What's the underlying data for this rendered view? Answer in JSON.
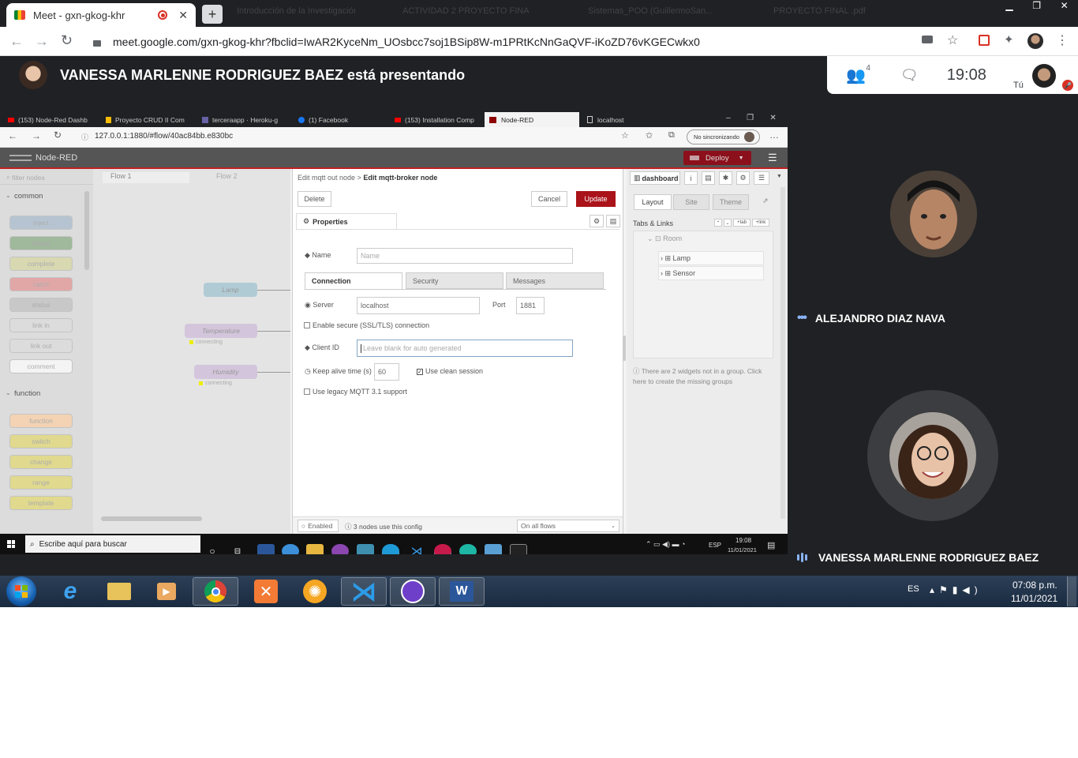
{
  "browser": {
    "active_tab_title": "Meet - gxn-gkog-khr",
    "other_tabs": [
      "Introducción de la Investigación",
      "ACTIVIDAD 2 PROYECTO FINAL",
      "Sistemas_POO (GuillermoSan...",
      "PROYECTO FINAL .pdf"
    ],
    "url": "meet.google.com/gxn-gkog-khr?fbclid=IwAR2KyceNm_UOsbcc7soj1BSip8W-m1PRtKcNnGaQVF-iKoZD76vKGECwkx0"
  },
  "meet": {
    "presenter_text": "VANESSA MARLENNE RODRIGUEZ BAEZ está presentando",
    "participant_count": "4",
    "clock": "19:08",
    "self_label": "Tú",
    "participants": [
      "ALEJANDRO DIAZ NAVA",
      "VANESSA MARLENNE RODRIGUEZ BAEZ"
    ]
  },
  "shared": {
    "edge_tabs": [
      "(153) Node-Red Dashb",
      "Proyecto CRUD II Com",
      "terceraapp · Heroku-g",
      "(1) Facebook",
      "(153) Installation Comp",
      "Node-RED",
      "localhost"
    ],
    "edge_url": "127.0.0.1:1880/#flow/40ac84bb.e830bc",
    "sync_label": "No sincronizando",
    "app_title": "Node-RED",
    "deploy_label": "Deploy",
    "filter_placeholder": "filter nodes",
    "palette": {
      "common_title": "common",
      "common": [
        "inject",
        "debug",
        "complete",
        "catch",
        "status",
        "link in",
        "link out",
        "comment"
      ],
      "function_title": "function",
      "function": [
        "function",
        "switch",
        "change",
        "range",
        "template"
      ]
    },
    "flow_tabs": [
      "Flow 1",
      "Flow 2"
    ],
    "flow_nodes": [
      "Lamp",
      "Temperature",
      "Humidity"
    ],
    "connecting": "connecting",
    "editor": {
      "breadcrumb_1": "Edit mqtt out node >",
      "breadcrumb_2": "Edit mqtt-broker node",
      "delete": "Delete",
      "cancel": "Cancel",
      "update": "Update",
      "properties": "Properties",
      "name_label": "Name",
      "name_placeholder": "Name",
      "tabs": [
        "Connection",
        "Security",
        "Messages"
      ],
      "server_label": "Server",
      "server_value": "localhost",
      "port_label": "Port",
      "port_value": "1881",
      "tls_label": "Enable secure (SSL/TLS) connection",
      "client_label": "Client ID",
      "client_placeholder": "Leave blank for auto generated",
      "keepalive_label": "Keep alive time (s)",
      "keepalive_value": "60",
      "clean_label": "Use clean session",
      "legacy_label": "Use legacy MQTT 3.1 support",
      "enabled": "Enabled",
      "nodes_use": "3 nodes use this config",
      "scope": "On all flows"
    },
    "dashboard": {
      "title": "dashboard",
      "tabs": [
        "Layout",
        "Site",
        "Theme"
      ],
      "tabs_links": "Tabs & Links",
      "tree": [
        "Room",
        "Lamp",
        "Sensor"
      ],
      "note": "There are 2 widgets not in a group. Click here to create the missing groups"
    },
    "win10": {
      "search": "Escribe aquí para buscar",
      "lang": "ESP",
      "time": "19:08",
      "date": "11/01/2021"
    }
  },
  "win7": {
    "lang": "ES",
    "time": "07:08 p.m.",
    "date": "11/01/2021"
  },
  "colors": {
    "meet_bg": "#202124",
    "nodered_red": "#aa1319",
    "w7_taskbar": "#1f3149"
  }
}
